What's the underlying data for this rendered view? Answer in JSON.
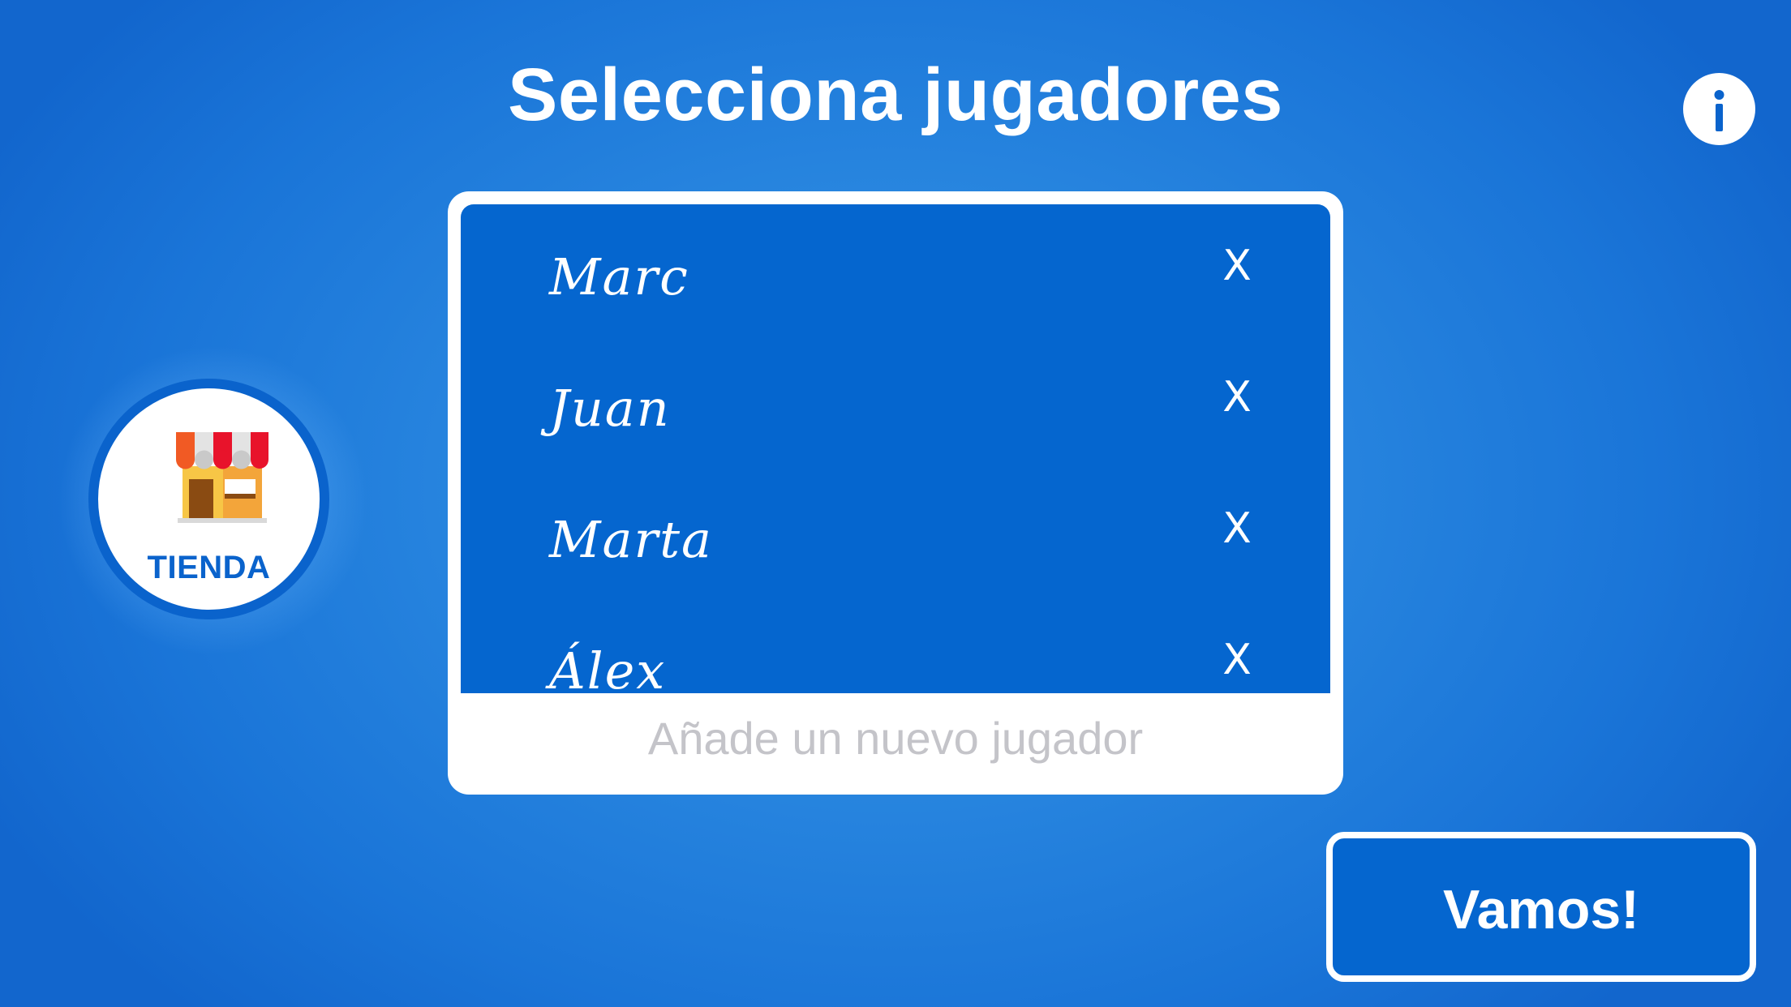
{
  "header": {
    "title": "Selecciona jugadores",
    "info_label": "i"
  },
  "shop": {
    "label": "TIENDA",
    "icon": "store-icon"
  },
  "players": {
    "items": [
      {
        "name": "Marc",
        "remove_label": "X"
      },
      {
        "name": "Juan",
        "remove_label": "X"
      },
      {
        "name": "Marta",
        "remove_label": "X"
      },
      {
        "name": "Álex",
        "remove_label": "X"
      }
    ],
    "add_placeholder": "Añade un nuevo jugador",
    "add_value": ""
  },
  "actions": {
    "go_label": "Vamos!"
  },
  "colors": {
    "background": "#2a88e0",
    "accent": "#0566cf",
    "panel": "#ffffff",
    "placeholder": "#c4c4c9"
  }
}
